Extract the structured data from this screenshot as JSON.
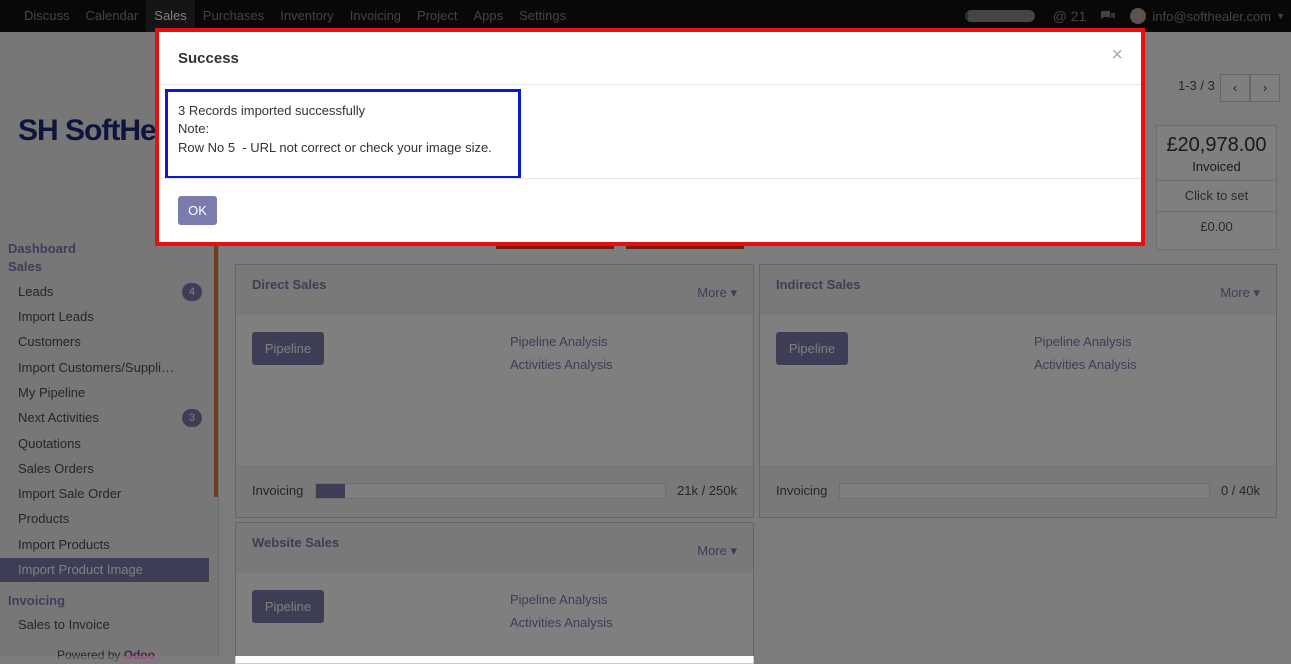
{
  "topnav": {
    "menu": [
      "Discuss",
      "Calendar",
      "Sales",
      "Purchases",
      "Inventory",
      "Invoicing",
      "Project",
      "Apps",
      "Settings"
    ],
    "active": "Sales",
    "progress_fraction": 0.05,
    "mentions": "@ 21",
    "user": "info@softhealer.com"
  },
  "sidebar": {
    "logo_text": "SH SoftHea",
    "dashboard_label": "Dashboard",
    "section_sales": "Sales",
    "items": [
      {
        "label": "Leads",
        "badge": "4"
      },
      {
        "label": "Import Leads",
        "badge": ""
      },
      {
        "label": "Customers",
        "badge": ""
      },
      {
        "label": "Import Customers/Suppli…",
        "badge": ""
      },
      {
        "label": "My Pipeline",
        "badge": ""
      },
      {
        "label": "Next Activities",
        "badge": "3"
      },
      {
        "label": "Quotations",
        "badge": ""
      },
      {
        "label": "Sales Orders",
        "badge": ""
      },
      {
        "label": "Import Sale Order",
        "badge": ""
      },
      {
        "label": "Products",
        "badge": ""
      },
      {
        "label": "Import Products",
        "badge": ""
      },
      {
        "label": "Import Product Image",
        "badge": ""
      }
    ],
    "section_invoicing": "Invoicing",
    "invoicing_items": [
      "Sales to Invoice"
    ],
    "powered_prefix": "Powered by",
    "powered_brand": "Odoo"
  },
  "pager": {
    "range": "1-3 / 3",
    "prev": "‹",
    "next": "›"
  },
  "invoiced": {
    "amount": "£20,978.00",
    "label": "Invoiced",
    "click_to_set": "Click to set",
    "target": "£0.00"
  },
  "cards": [
    {
      "title": "Direct Sales",
      "more": "More ▾",
      "pipeline": "Pipeline",
      "link1": "Pipeline Analysis",
      "link2": "Activities Analysis",
      "inv_label": "Invoicing",
      "inv_value": "21k / 250k",
      "inv_fraction": 0.084
    },
    {
      "title": "Indirect Sales",
      "more": "More ▾",
      "pipeline": "Pipeline",
      "link1": "Pipeline Analysis",
      "link2": "Activities Analysis",
      "inv_label": "Invoicing",
      "inv_value": "0 / 40k",
      "inv_fraction": 0
    },
    {
      "title": "Website Sales",
      "more": "More ▾",
      "pipeline": "Pipeline",
      "link1": "Pipeline Analysis",
      "link2": "Activities Analysis"
    }
  ],
  "modal": {
    "title": "Success",
    "close": "×",
    "line1": "3 Records imported successfully",
    "line2": "Note:",
    "line3": "Row No 5  - URL not correct or check your image size.",
    "ok": "OK",
    "highlight_color": "#e8100f",
    "message_box_color": "#0a19d4"
  }
}
